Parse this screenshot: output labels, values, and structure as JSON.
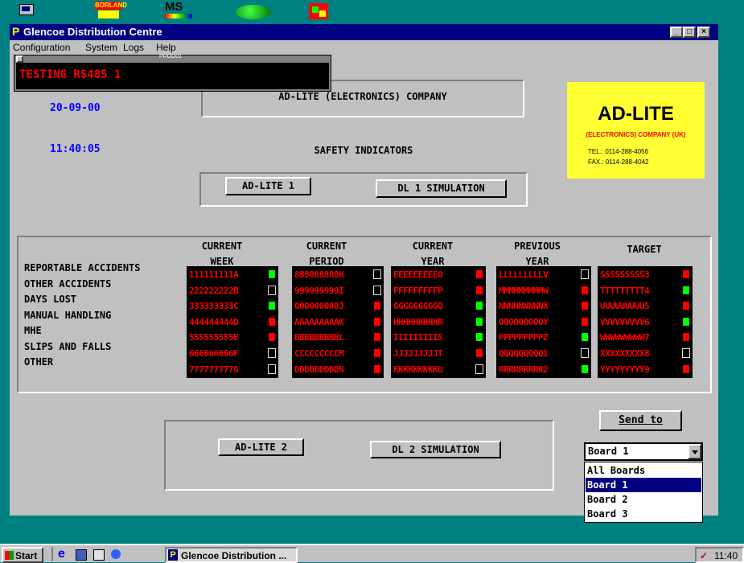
{
  "desktop": {
    "icons": [
      {
        "name": "computer-icon"
      },
      {
        "name": "borland-icon",
        "label": "BORLAND"
      },
      {
        "name": "ms-icon",
        "label": "MS"
      },
      {
        "name": "green-blob-icon"
      },
      {
        "name": "paint-icon"
      }
    ]
  },
  "window": {
    "title": "Glencoe Distribution Centre",
    "menu": [
      "Configuration",
      "System",
      "Logs",
      "Help"
    ]
  },
  "prod_panel": {
    "title": "PROD01",
    "text": "TESTING RS485 1"
  },
  "header": {
    "date": "20-09-00",
    "time": "11:40:05",
    "company": "AD-LITE (ELECTRONICS) COMPANY",
    "subtitle": "SAFETY INDICATORS"
  },
  "logo": {
    "brand": "AD-LITE",
    "company": "(ELECTRONICS) COMPANY (UK)",
    "tel": "TEL.: 0114-288-4056",
    "fax": "FAX.: 0114-288-4042",
    "bg_color": "#ffff33",
    "text_color": "#ff0000"
  },
  "buttons": {
    "adlite1": "AD-LITE 1",
    "dl1": "DL 1 SIMULATION",
    "adlite2": "AD-LITE 2",
    "dl2": "DL 2 SIMULATION",
    "send_to": "Send to"
  },
  "table": {
    "columns": [
      {
        "line1": "CURRENT",
        "line2": "WEEK"
      },
      {
        "line1": "CURRENT",
        "line2": "PERIOD"
      },
      {
        "line1": "CURRENT",
        "line2": "YEAR"
      },
      {
        "line1": "PREVIOUS",
        "line2": "YEAR"
      },
      {
        "line1": "TARGET",
        "line2": ""
      }
    ],
    "rows": [
      "REPORTABLE ACCIDENTS",
      "OTHER ACCIDENTS",
      "DAYS LOST",
      "MANUAL HANDLING",
      "MHE",
      "SLIPS AND FALLS",
      "OTHER"
    ],
    "cells": [
      [
        "111111111A",
        "222222222B",
        "333333333C",
        "444444444D",
        "555555555E",
        "666666666F",
        "777777777G"
      ],
      [
        "888888888H",
        "999999999I",
        "000000000J",
        "AAAAAAAAAK",
        "BBBBBBBBBL",
        "CCCCCCCCCM",
        "DDDDDDDDDN"
      ],
      [
        "EEEEEEEEEO",
        "FFFFFFFFFP",
        "GGGGGGGGGQ",
        "HHHHHHHHHR",
        "IIIIIIIIIS",
        "JJJJJJJJJT",
        "KKKKKKKKKU"
      ],
      [
        "LLLLLLLLLV",
        "MMMMMMMMMW",
        "NNNNNNNNNX",
        "OOOOOOOOOY",
        "PPPPPPPPPZ",
        "QQQQQQQQQ1",
        "RRRRRRRRR2"
      ],
      [
        "SSSSSSSSS3",
        "TTTTTTTTT4",
        "UUUUUUUUU5",
        "VVVVVVVVV6",
        "WWWWWWWWW7",
        "XXXXXXXXX8",
        "YYYYYYYYY9"
      ]
    ],
    "indicators": [
      [
        "green",
        "black",
        "green",
        "red",
        "red",
        "black",
        "black"
      ],
      [
        "black",
        "black",
        "red",
        "red",
        "red",
        "red",
        "red"
      ],
      [
        "red",
        "red",
        "green",
        "green",
        "green",
        "red",
        "black"
      ],
      [
        "black",
        "red",
        "red",
        "red",
        "green",
        "black",
        "green"
      ],
      [
        "red",
        "green",
        "red",
        "green",
        "red",
        "black",
        "red"
      ]
    ],
    "colors": {
      "green": "#00ff00",
      "red": "#ff0000",
      "black": "#000000"
    }
  },
  "board_select": {
    "selected": "Board 1",
    "options": [
      "All Boards",
      "Board 1",
      "Board 2",
      "Board 3"
    ],
    "highlighted": "Board 1"
  },
  "taskbar": {
    "start": "Start",
    "task": "Glencoe Distribution ...",
    "clock": "11:40"
  }
}
